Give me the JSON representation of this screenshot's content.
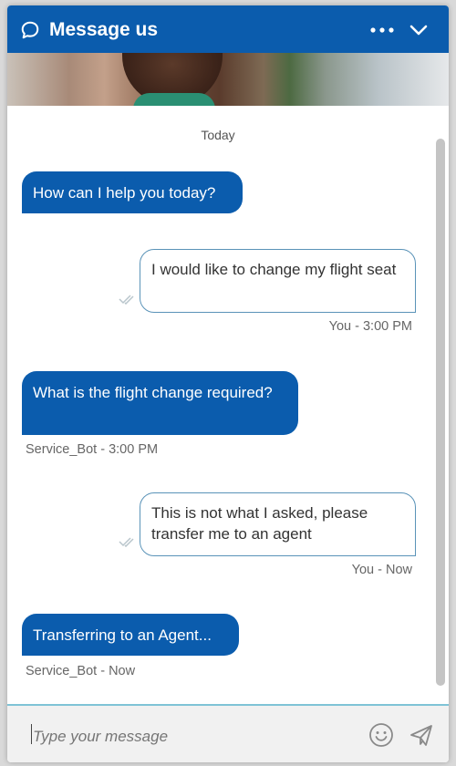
{
  "header": {
    "title": "Message us",
    "more_icon": "more-horizontal-icon",
    "collapse_icon": "chevron-down-icon",
    "chat_icon": "chat-bubble-icon",
    "color": "#0b5cad"
  },
  "conversation": {
    "date_label": "Today",
    "messages": [
      {
        "from": "bot",
        "text": "How can I help you today?"
      },
      {
        "from": "user",
        "text": "I would like to change my flight seat",
        "meta": "You - 3:00 PM"
      },
      {
        "from": "bot",
        "text": "What is the flight change required?",
        "meta": "Service_Bot - 3:00 PM"
      },
      {
        "from": "user",
        "text": "This is not what I asked, please transfer me to an agent",
        "meta": "You - Now"
      },
      {
        "from": "bot",
        "text": "Transferring to an Agent...",
        "meta": "Service_Bot - Now"
      }
    ]
  },
  "composer": {
    "placeholder": "Type your message",
    "emoji_icon": "emoji-smile-icon",
    "send_icon": "send-paper-plane-icon"
  }
}
